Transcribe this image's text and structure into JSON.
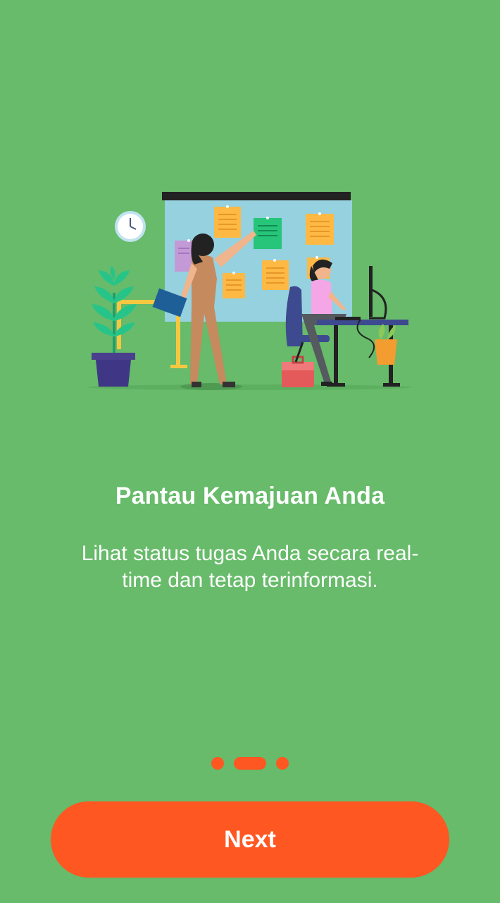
{
  "onboarding": {
    "title": "Pantau Kemajuan Anda",
    "description": "Lihat status tugas Anda secara real-time dan tetap terinformasi.",
    "illustration": "office-team-progress-board-illustration",
    "pager": {
      "total": 3,
      "current": 2
    },
    "next_label": "Next"
  },
  "colors": {
    "background": "#67bb6a",
    "accent": "#ff5722",
    "text": "#ffffff"
  }
}
